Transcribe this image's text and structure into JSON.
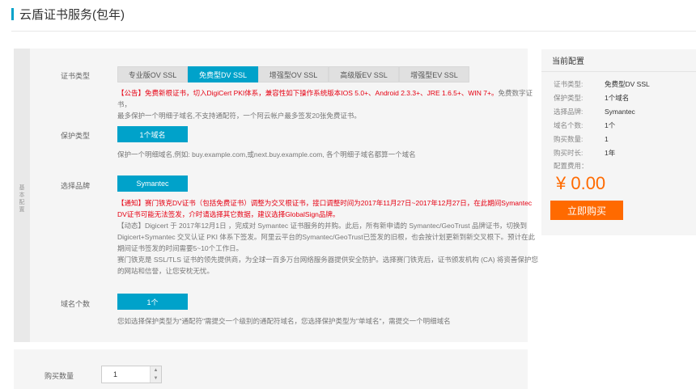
{
  "page": {
    "title": "云盾证书服务(包年)"
  },
  "config": {
    "strip_label": "基本配置",
    "cert_type": {
      "label": "证书类型",
      "tabs": [
        "专业版OV SSL",
        "免费型DV SSL",
        "增强型OV SSL",
        "高级版EV SSL",
        "增强型EV SSL"
      ],
      "selected": "免费型DV SSL",
      "notice_red": "【公告】免费新根证书，切入DigiCert PKI体系，兼容性如下操作系统版本IOS 5.0+、Android 2.3.3+、JRE 1.6.5+、WIN 7+。",
      "notice_gray_1": "免费数字证书，",
      "notice_gray_2": "最多保护一个明细子域名,不支持通配符，一个阿云帐户最多签发20张免费证书。"
    },
    "protect_type": {
      "label": "保护类型",
      "selected": "1个域名",
      "desc": "保护一个明细域名,例如: buy.example.com,或next.buy.example.com, 各个明细子域名都算一个域名"
    },
    "brand": {
      "label": "选择品牌",
      "selected": "Symantec",
      "notice_red_1": "【通知】赛门铁克DV证书（包括免费证书）调整为交叉根证书，接口调整时间为2017年11月27日~2017年12月27日，在此期间Symantec",
      "notice_red_2": "DV证书可能无法签发，介时请选择其它数据，建议选择GlobalSign品牌。",
      "dyn_1": "【动态】Digicert 于 2017年12月1日 ，完成对 Symantec 证书服务的并购。此后，所有新申请的 Symantec/GeoTrust 品牌证书，切换到",
      "dyn_2": "Digicert+Symantec 交叉认证 PKI 体系下签发。阿里云平台的Symantec/GeoTrust已签发的旧根，也会按计划更新到新交叉根下。预计在此",
      "dyn_3": "期间证书签发的时间需要5~10个工作日。",
      "desc_1": "赛门铁克是 SSL/TLS 证书的领先提供商，为全球一百多万台网络服务器提供安全防护。选择赛门铁克后，证书颁发机构 (CA) 将资善保护您",
      "desc_2": "的网站和信誉，让您安枕无忧。"
    },
    "domain_count": {
      "label": "域名个数",
      "selected": "1个",
      "desc": "您如选择保护类型为\"通配符\"需提交一个级别的通配符域名，您选择保护类型为\"单域名\"，需提交一个明细域名"
    }
  },
  "quantity": {
    "label": "购买数量",
    "value": "1",
    "up_icon": "▲",
    "down_icon": "▼"
  },
  "summary": {
    "title": "当前配置",
    "rows": [
      {
        "k": "证书类型:",
        "v": "免费型DV SSL"
      },
      {
        "k": "保护类型:",
        "v": "1个域名"
      },
      {
        "k": "选择品牌:",
        "v": "Symantec"
      },
      {
        "k": "域名个数:",
        "v": "1个"
      },
      {
        "k": "购买数量:",
        "v": "1"
      },
      {
        "k": "购买时长:",
        "v": "1年"
      }
    ],
    "fee_label": "配置费用：",
    "price": "¥ 0.00",
    "buy_label": "立即购买"
  },
  "colors": {
    "accent": "#00a2ca",
    "orange": "#ff6a00",
    "red": "#e60012"
  }
}
